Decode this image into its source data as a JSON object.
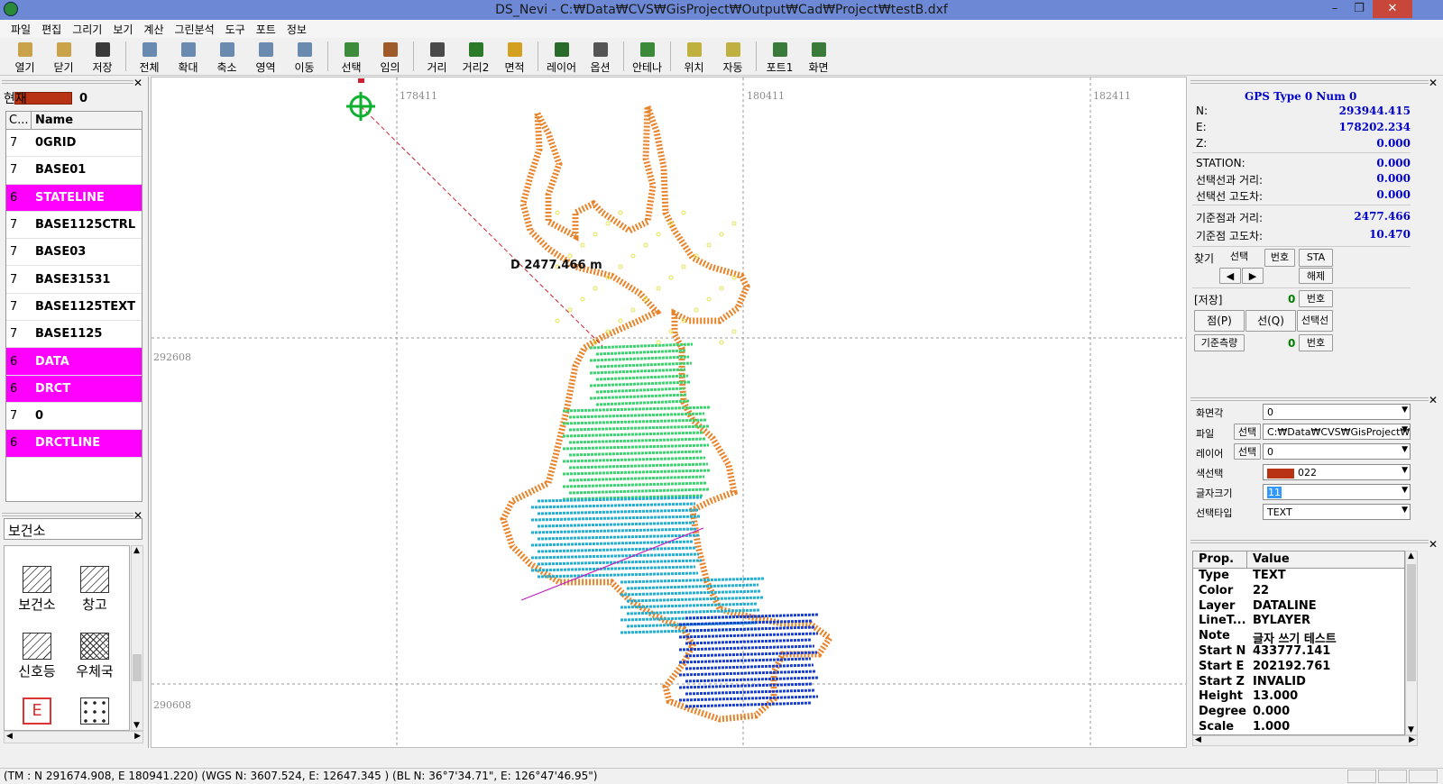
{
  "window": {
    "title": "DS_Nevi - C:₩Data₩CVS₩GisProject₩Output₩Cad₩Project₩testB.dxf"
  },
  "menu": [
    "파일",
    "편집",
    "그리기",
    "보기",
    "계산",
    "그린분석",
    "도구",
    "포트",
    "정보"
  ],
  "toolbar": [
    {
      "label": "열기",
      "icon": "folder-open-icon",
      "color": "#c9a24a"
    },
    {
      "label": "닫기",
      "icon": "folder-close-icon",
      "color": "#c9a24a"
    },
    {
      "label": "저장",
      "icon": "save-icon",
      "color": "#3a3a3a"
    },
    {
      "label": "전체",
      "icon": "zoom-all-icon",
      "color": "#6a8ab0"
    },
    {
      "label": "확대",
      "icon": "zoom-in-icon",
      "color": "#6a8ab0"
    },
    {
      "label": "축소",
      "icon": "zoom-out-icon",
      "color": "#6a8ab0"
    },
    {
      "label": "영역",
      "icon": "zoom-area-icon",
      "color": "#6a8ab0"
    },
    {
      "label": "이동",
      "icon": "pan-icon",
      "color": "#6a8ab0"
    },
    {
      "label": "선택",
      "icon": "select-icon",
      "color": "#3c8c3c"
    },
    {
      "label": "임의",
      "icon": "random-icon",
      "color": "#a05a2a"
    },
    {
      "label": "거리",
      "icon": "distance-icon",
      "color": "#4a4a4a"
    },
    {
      "label": "거리2",
      "icon": "distance2-icon",
      "color": "#2a7a2a"
    },
    {
      "label": "면적",
      "icon": "area-icon",
      "color": "#d4a020"
    },
    {
      "label": "레이어",
      "icon": "layer-icon",
      "color": "#2a6a2a"
    },
    {
      "label": "옵션",
      "icon": "option-icon",
      "color": "#555555"
    },
    {
      "label": "안테나",
      "icon": "antenna-icon",
      "color": "#3a8a3a"
    },
    {
      "label": "위치",
      "icon": "location-icon",
      "color": "#c0b040"
    },
    {
      "label": "자동",
      "icon": "auto-icon",
      "color": "#c0b040"
    },
    {
      "label": "포트1",
      "icon": "port-icon",
      "color": "#3a7a3a"
    },
    {
      "label": "화면",
      "icon": "screen-icon",
      "color": "#3a7a3a"
    }
  ],
  "layer_panel": {
    "current_label": "현재",
    "current_value": "0",
    "header_c": "C...",
    "header_name": "Name",
    "rows": [
      {
        "c": "7",
        "name": "0GRID",
        "highlight": false
      },
      {
        "c": "7",
        "name": "BASE01",
        "highlight": false
      },
      {
        "c": "6",
        "name": "STATELINE",
        "highlight": true
      },
      {
        "c": "7",
        "name": "BASE1125CTRL",
        "highlight": false
      },
      {
        "c": "7",
        "name": "BASE03",
        "highlight": false
      },
      {
        "c": "7",
        "name": "BASE31531",
        "highlight": false
      },
      {
        "c": "7",
        "name": "BASE1125TEXT",
        "highlight": false
      },
      {
        "c": "7",
        "name": "BASE1125",
        "highlight": false
      },
      {
        "c": "6",
        "name": "DATA",
        "highlight": true
      },
      {
        "c": "6",
        "name": "DRCT",
        "highlight": true
      },
      {
        "c": "7",
        "name": "0",
        "highlight": false
      },
      {
        "c": "6",
        "name": "DRCTLINE",
        "highlight": true
      }
    ]
  },
  "symbol_panel": {
    "search_value": "보건소",
    "symbols": [
      {
        "label": "보건소",
        "icon": "hatch-icon"
      },
      {
        "label": "창고",
        "icon": "hatch-icon"
      },
      {
        "label": "신호등",
        "icon": "diagonal-icon"
      },
      {
        "label": "우체국",
        "icon": "crosshatch-icon"
      },
      {
        "label": "",
        "icon": "e-symbol-icon",
        "glyph": "E"
      },
      {
        "label": "",
        "icon": "dots-icon"
      }
    ]
  },
  "map": {
    "grid_labels_x": [
      "178411",
      "180411",
      "182411"
    ],
    "grid_labels_y": [
      "292608",
      "290608"
    ],
    "measure_label": "D 2477.466 m",
    "colors": {
      "outline": "#e8832a",
      "shallow": "#e4e44a",
      "mid": "#37d66c",
      "deep": "#1fb0d8",
      "deepest": "#1a3fd0",
      "measure": "#d02030",
      "section": "#c020c0",
      "target": "#10b030"
    }
  },
  "gps": {
    "header": "GPS Type 0   Num 0",
    "N_label": "N:",
    "N": "293944.415",
    "E_label": "E:",
    "E": "178202.234",
    "Z_label": "Z:",
    "Z": "0.000",
    "station_label": "STATION:",
    "station": "0.000",
    "sel_dist_label": "선택선과 거리:",
    "sel_dist": "0.000",
    "sel_elev_label": "선택선 고도차:",
    "sel_elev": "0.000",
    "ref_dist_label": "기준점과 거리:",
    "ref_dist": "2477.466",
    "ref_elev_label": "기준점 고도차:",
    "ref_elev": "10.470",
    "find_label": "찾기",
    "btn_select": "선택",
    "btn_number": "번호",
    "btn_sta": "STA",
    "btn_prev": "◀",
    "btn_next": "▶",
    "btn_release": "해제",
    "save_label": "[저장]",
    "save_count": "0",
    "btn_save_number": "번호",
    "btn_point": "점(P)",
    "btn_line": "선(Q)",
    "btn_selline": "선택선",
    "btn_ref": "기준측량",
    "ref_count": "0",
    "btn_ref_number": "번호"
  },
  "options": {
    "angle_label": "화면각",
    "angle_value": "0",
    "file_label": "파일",
    "file_btn": "선택",
    "file_value": "C:₩Data₩CVS₩GisProject₩",
    "layer_label": "레이어",
    "layer_btn": "선택",
    "layer_value": "0",
    "color_label": "색선택",
    "color_value": "022",
    "color_swatch": "#b83214",
    "fontsize_label": "글자크기",
    "fontsize_value": "11",
    "seltype_label": "선택타입",
    "seltype_value": "TEXT"
  },
  "properties": {
    "header_prop": "Prop.",
    "header_value": "Value",
    "rows": [
      {
        "k": "Type",
        "v": "TEXT"
      },
      {
        "k": "Color",
        "v": "22"
      },
      {
        "k": "Layer",
        "v": "DATALINE"
      },
      {
        "k": "LineT...",
        "v": "BYLAYER"
      },
      {
        "k": "Note",
        "v": "글자 쓰기 테스트"
      },
      {
        "k": "Start N",
        "v": "433777.141"
      },
      {
        "k": "Start E",
        "v": "202192.761"
      },
      {
        "k": "Start Z",
        "v": "INVALID"
      },
      {
        "k": "Height",
        "v": "13.000"
      },
      {
        "k": "Degree",
        "v": "0.000"
      },
      {
        "k": "Scale",
        "v": "1.000"
      }
    ]
  },
  "statusbar": {
    "text": "(TM : N 291674.908, E 180941.220)  (WGS N: 3607.524, E: 12647.345 )   (BL N: 36°7'34.71\", E: 126°47'46.95\")"
  }
}
